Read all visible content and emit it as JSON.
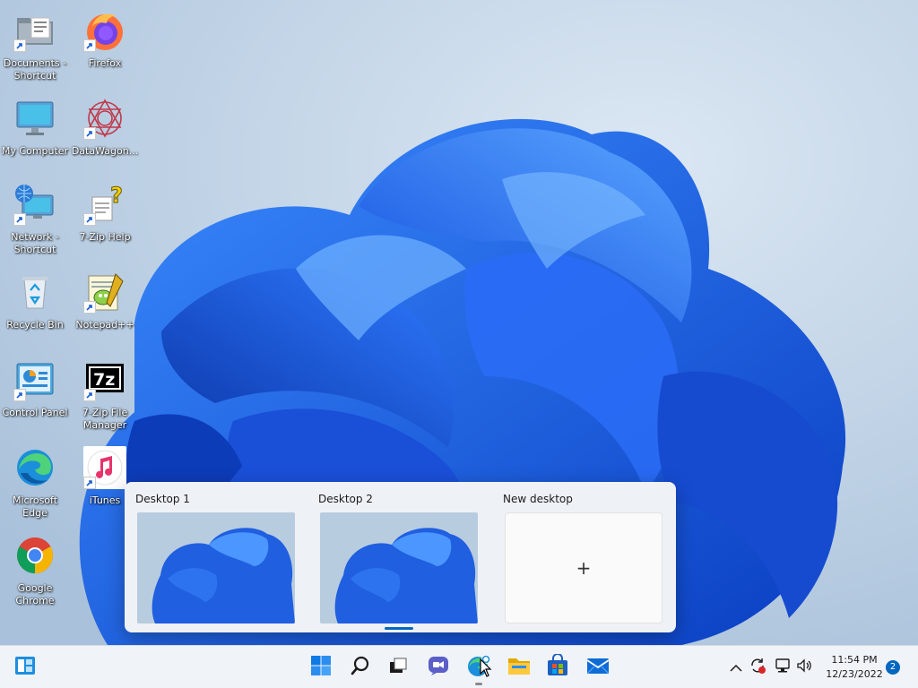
{
  "desktop_icons": [
    {
      "label": "Documents - Shortcut",
      "icon": "folder-documents-icon"
    },
    {
      "label": "Firefox",
      "icon": "firefox-icon"
    },
    {
      "label": "My Computer",
      "icon": "monitor-icon"
    },
    {
      "label": "DataWagon...",
      "icon": "datawagon-icon"
    },
    {
      "label": "Network - Shortcut",
      "icon": "network-icon"
    },
    {
      "label": "7-Zip Help",
      "icon": "help-document-icon"
    },
    {
      "label": "Recycle Bin",
      "icon": "recycle-bin-icon"
    },
    {
      "label": "Notepad++",
      "icon": "notepadpp-icon"
    },
    {
      "label": "Control Panel",
      "icon": "control-panel-icon"
    },
    {
      "label": "7-Zip File Manager",
      "icon": "7zip-icon"
    },
    {
      "label": "Microsoft Edge",
      "icon": "edge-icon"
    },
    {
      "label": "iTunes",
      "icon": "itunes-icon"
    },
    {
      "label": "Google Chrome",
      "icon": "chrome-icon"
    }
  ],
  "task_view": {
    "desktops": [
      {
        "title": "Desktop 1"
      },
      {
        "title": "Desktop 2"
      },
      {
        "title": "New desktop",
        "symbol": "+"
      }
    ]
  },
  "taskbar": {
    "items": [
      "widgets-icon",
      "start-icon",
      "search-icon",
      "task-view-icon",
      "chat-icon",
      "edge-icon",
      "file-explorer-icon",
      "store-icon",
      "mail-icon"
    ],
    "tray": [
      "chevron-up-icon",
      "update-icon",
      "network-icon",
      "volume-icon"
    ],
    "time": "11:54 PM",
    "date": "12/23/2022",
    "notification_count": "2"
  },
  "colors": {
    "accent": "#0067c0",
    "wallpaper_blue": "#1f5fe0",
    "taskbar": "#f0f3f8"
  }
}
